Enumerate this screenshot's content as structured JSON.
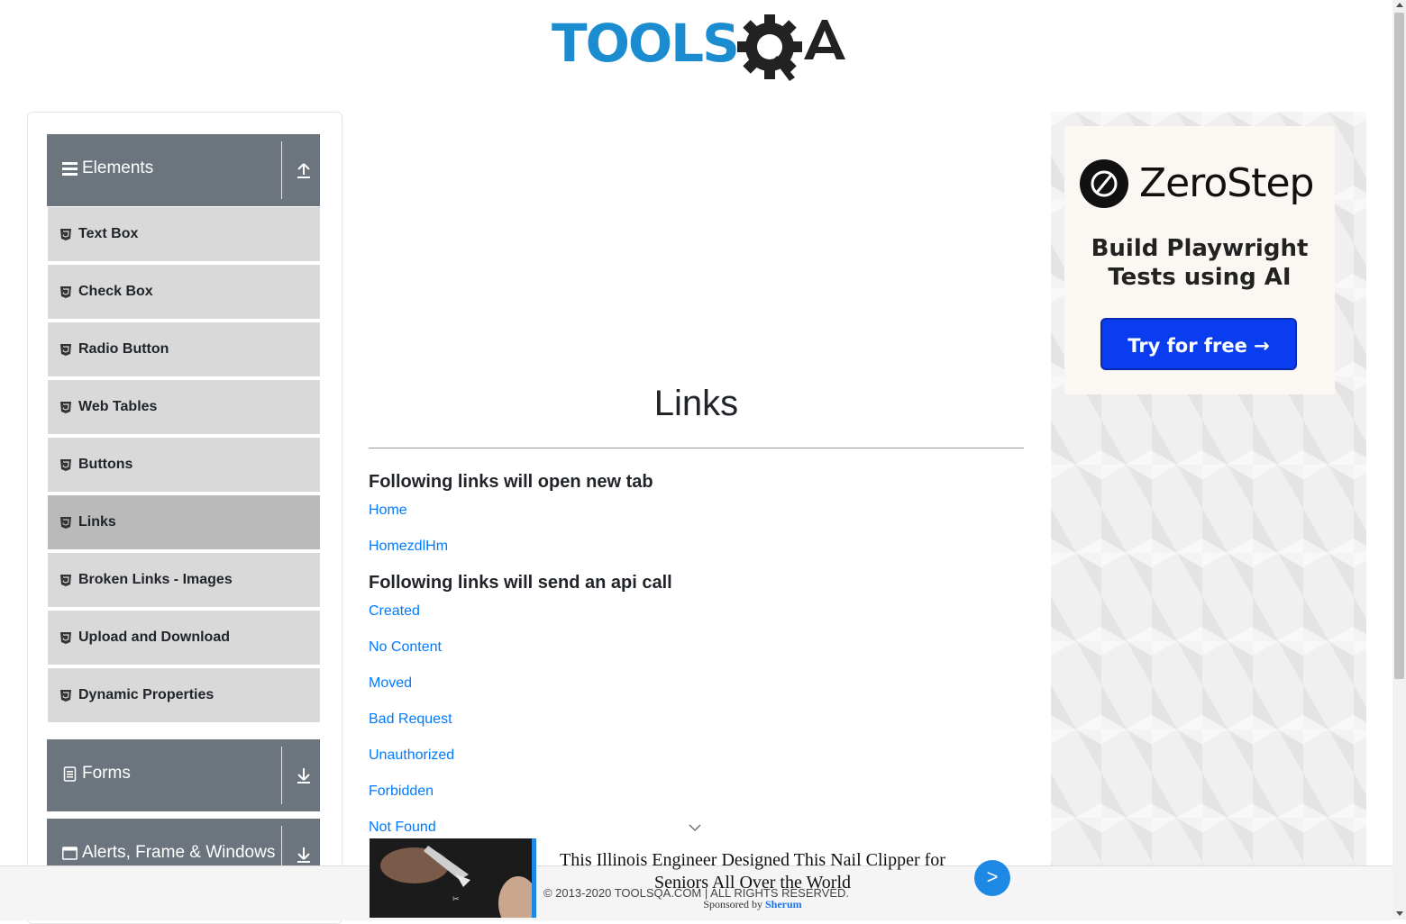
{
  "header": {
    "logo_text": "TOOLS",
    "logo_suffix": "QA"
  },
  "sidebar": {
    "groups": [
      {
        "label": "Elements",
        "icon": "hamburger-icon",
        "toggle_icon": "upload-arrow-icon"
      },
      {
        "label": "Forms",
        "icon": "document-icon",
        "toggle_icon": "download-arrow-icon"
      },
      {
        "label": "Alerts, Frame & Windows",
        "icon": "window-icon",
        "toggle_icon": "download-arrow-icon"
      }
    ],
    "items": [
      {
        "label": "Text Box"
      },
      {
        "label": "Check Box"
      },
      {
        "label": "Radio Button"
      },
      {
        "label": "Web Tables"
      },
      {
        "label": "Buttons"
      },
      {
        "label": "Links",
        "active": true
      },
      {
        "label": "Broken Links - Images"
      },
      {
        "label": "Upload and Download"
      },
      {
        "label": "Dynamic Properties"
      }
    ]
  },
  "main": {
    "title": "Links",
    "section1": {
      "heading": "Following links will open new tab",
      "links": [
        "Home",
        "HomezdlHm"
      ]
    },
    "section2": {
      "heading": "Following links will send an api call",
      "links": [
        "Created",
        "No Content",
        "Moved",
        "Bad Request",
        "Unauthorized",
        "Forbidden",
        "Not Found"
      ]
    }
  },
  "ad": {
    "brand": "ZeroStep",
    "tagline_line1": "Build Playwright",
    "tagline_line2": "Tests using AI",
    "cta": "Try for free →"
  },
  "bottom_ad": {
    "headline": "This Illinois Engineer Designed This Nail Clipper for Seniors All Over the World",
    "sponsor_prefix": "Sponsored by",
    "sponsor_name": "Sherum",
    "next_label": ">"
  },
  "footer": {
    "copyright": "© 2013-2020 TOOLSQA.COM | ALL RIGHTS RESERVED."
  },
  "colors": {
    "link": "#007bff",
    "sidebar_header": "#6c757d",
    "menu_item": "#d9d9d9",
    "menu_active": "#bababa",
    "logo_blue": "#1a8ccf"
  }
}
